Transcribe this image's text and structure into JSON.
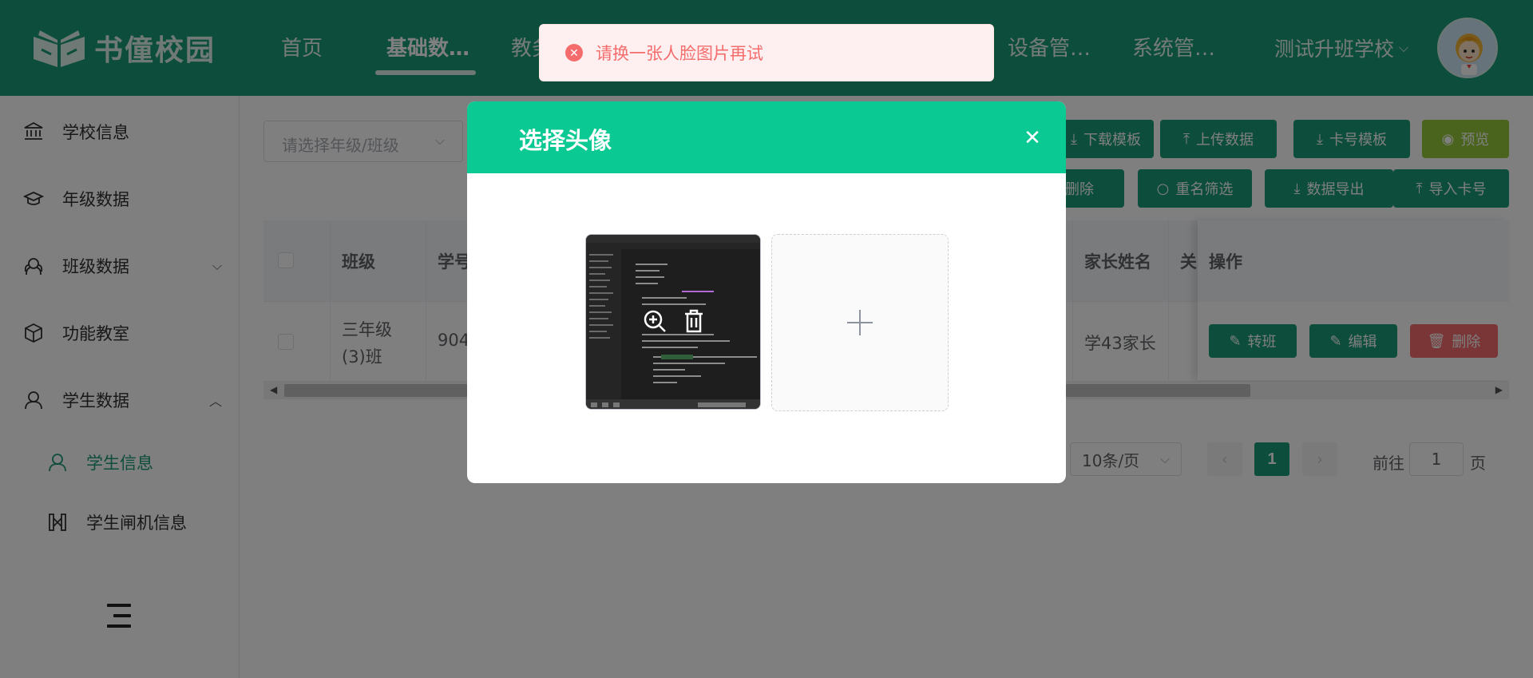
{
  "brand": {
    "name": "书僮校园"
  },
  "nav": {
    "items": [
      {
        "label": "首页"
      },
      {
        "label": "基础数…"
      },
      {
        "label": "教务"
      },
      {
        "label": "设备管…"
      },
      {
        "label": "系统管…"
      }
    ],
    "school": "测试升班学校",
    "avatar_icon": "cartoon-avatar-icon"
  },
  "sidebar": {
    "items": [
      {
        "label": "学校信息",
        "icon": "bank-icon"
      },
      {
        "label": "年级数据",
        "icon": "graduation-cap-icon"
      },
      {
        "label": "班级数据",
        "icon": "group-icon"
      },
      {
        "label": "功能教室",
        "icon": "cube-icon"
      },
      {
        "label": "学生数据",
        "icon": "student-icon"
      }
    ],
    "sub_items": [
      {
        "label": "学生信息"
      },
      {
        "label": "学生闸机信息"
      }
    ]
  },
  "filters": {
    "grade_class_placeholder": "请选择年级/班级"
  },
  "toolbar": {
    "row1": [
      "下载模板",
      "上传数据",
      "卡号模板",
      "预览"
    ],
    "row2": [
      "批量删除",
      "重名筛选",
      "数据导出",
      "导入卡号"
    ]
  },
  "table": {
    "headers": {
      "class": "班级",
      "student_no": "学号",
      "parent_name": "家长姓名",
      "relation": "关",
      "actions": "操作"
    },
    "rows": [
      {
        "class_line1": "三年级",
        "class_line2": "(3)班",
        "student_no": "904",
        "parent_name": "学43家长"
      }
    ],
    "row_actions": {
      "transfer": "转班",
      "edit": "编辑",
      "delete": "删除"
    }
  },
  "pagination": {
    "page_size": "10条/页",
    "current_page": "1",
    "goto_prefix": "前往",
    "goto_value": "1",
    "goto_suffix": "页"
  },
  "dialog": {
    "title": "选择头像",
    "close_icon": "close-icon"
  },
  "toast": {
    "message": "请换一张人脸图片再试"
  },
  "colors": {
    "brand": "#1a9b77",
    "dialog_header": "#0bc993",
    "danger": "#f56c6c",
    "warning_green": "#94c83a"
  }
}
